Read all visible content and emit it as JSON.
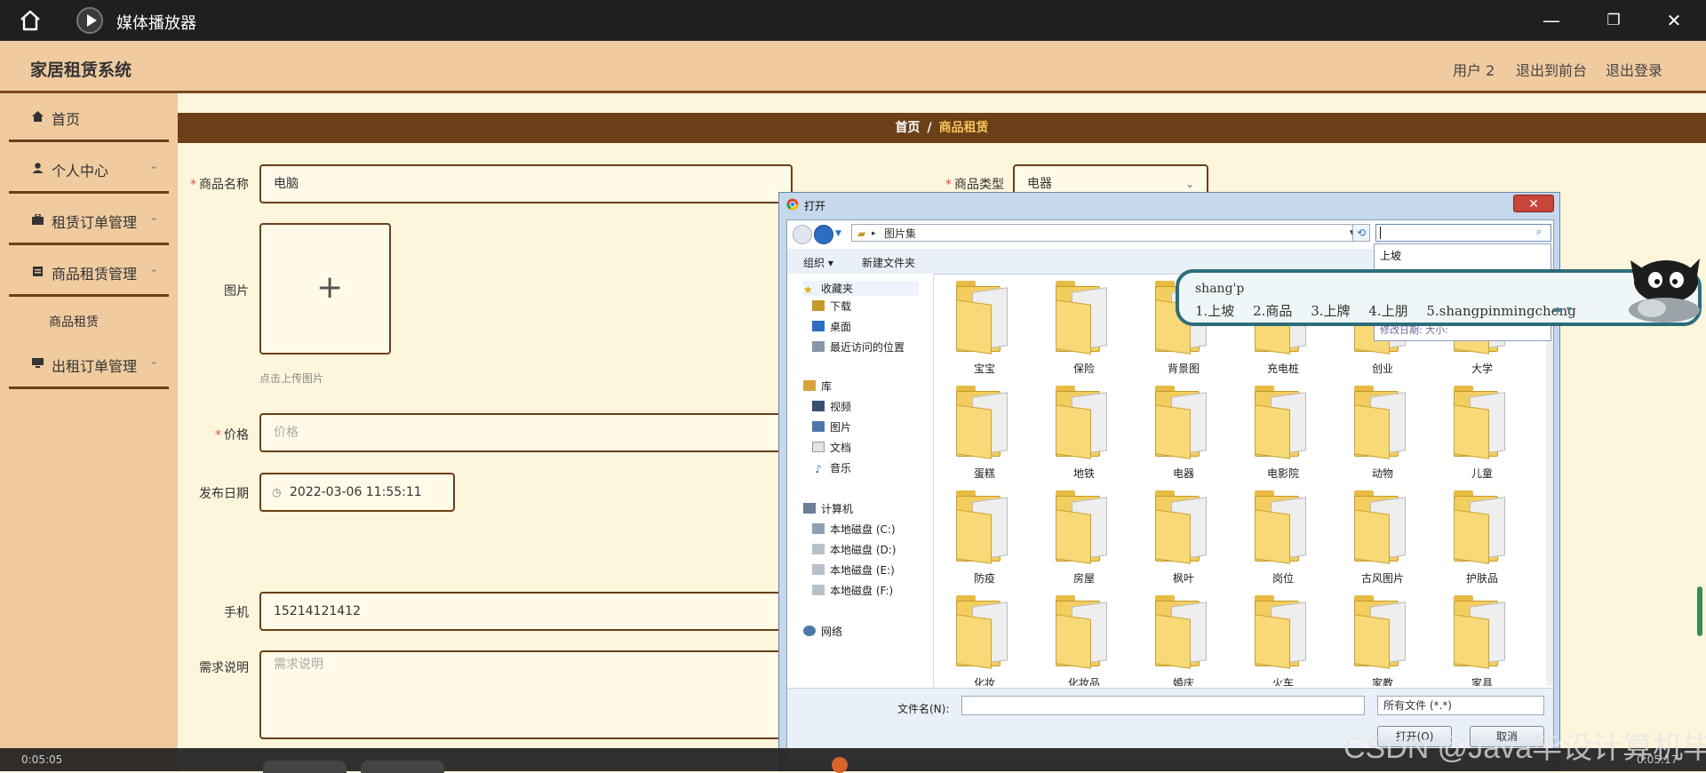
{
  "player": {
    "title": "媒体播放器",
    "controls": {
      "minimize": "—",
      "maximize": "❐",
      "close": "✕"
    },
    "time_current": "0:05:05",
    "time_total": "0:05:17"
  },
  "app": {
    "title": "家居租赁系统",
    "header_links": [
      "用户 2",
      "退出到前台",
      "退出登录"
    ]
  },
  "sidebar": {
    "items": [
      {
        "label": "首页",
        "icon": "home-icon"
      },
      {
        "label": "个人中心",
        "icon": "user-icon"
      },
      {
        "label": "租赁订单管理",
        "icon": "briefcase-icon"
      },
      {
        "label": "商品租赁管理",
        "icon": "clipboard-icon"
      },
      {
        "label": "出租订单管理",
        "icon": "monitor-icon"
      }
    ],
    "sub_item": "商品租赁"
  },
  "breadcrumb": {
    "home": "首页",
    "separator": "/",
    "current": "商品租赁"
  },
  "form": {
    "name_label": "商品名称",
    "name_value": "电脑",
    "type_label": "商品类型",
    "type_value": "电器",
    "image_label": "图片",
    "upload_hint": "点击上传图片",
    "price_label": "价格",
    "price_placeholder": "价格",
    "date_label": "发布日期",
    "date_value": "2022-03-06 11:55:11",
    "phone_label": "手机",
    "phone_value": "15214121412",
    "desc_label": "需求说明",
    "desc_placeholder": "需求说明"
  },
  "dialog": {
    "title": "打开",
    "address": "图片集",
    "toolbar": {
      "organize": "组织 ▾",
      "new_folder": "新建文件夹"
    },
    "tree": {
      "favorites": "收藏夹",
      "favorites_items": [
        "下载",
        "桌面",
        "最近访问的位置"
      ],
      "libraries": "库",
      "libraries_items": [
        "视频",
        "图片",
        "文档",
        "音乐"
      ],
      "computer": "计算机",
      "drives": [
        "本地磁盘 (C:)",
        "本地磁盘 (D:)",
        "本地磁盘 (E:)",
        "本地磁盘 (F:)"
      ],
      "network": "网络"
    },
    "folders": [
      "宝宝",
      "保险",
      "背景图",
      "充电桩",
      "创业",
      "大学",
      "蛋糕",
      "地铁",
      "电器",
      "电影院",
      "动物",
      "儿童",
      "防疫",
      "房屋",
      "枫叶",
      "岗位",
      "古风图片",
      "护肤品",
      "化妆",
      "化妆品",
      "婚庆",
      "火车",
      "家教",
      "家具"
    ],
    "filename_label": "文件名(N):",
    "filename_value": "",
    "filetype": "所有文件 (*.*)",
    "open_button": "打开(O)",
    "cancel_button": "取消"
  },
  "search_autocomplete": {
    "item": "上坡",
    "meta": "修改日期:  大小:"
  },
  "ime": {
    "composition": "shang'p",
    "candidates": [
      "1.上坡",
      "2.商品",
      "3.上牌",
      "4.上朋",
      "5.shangpinmingcheng"
    ]
  },
  "watermark": "CSDN @Java毕设计算机毕设"
}
